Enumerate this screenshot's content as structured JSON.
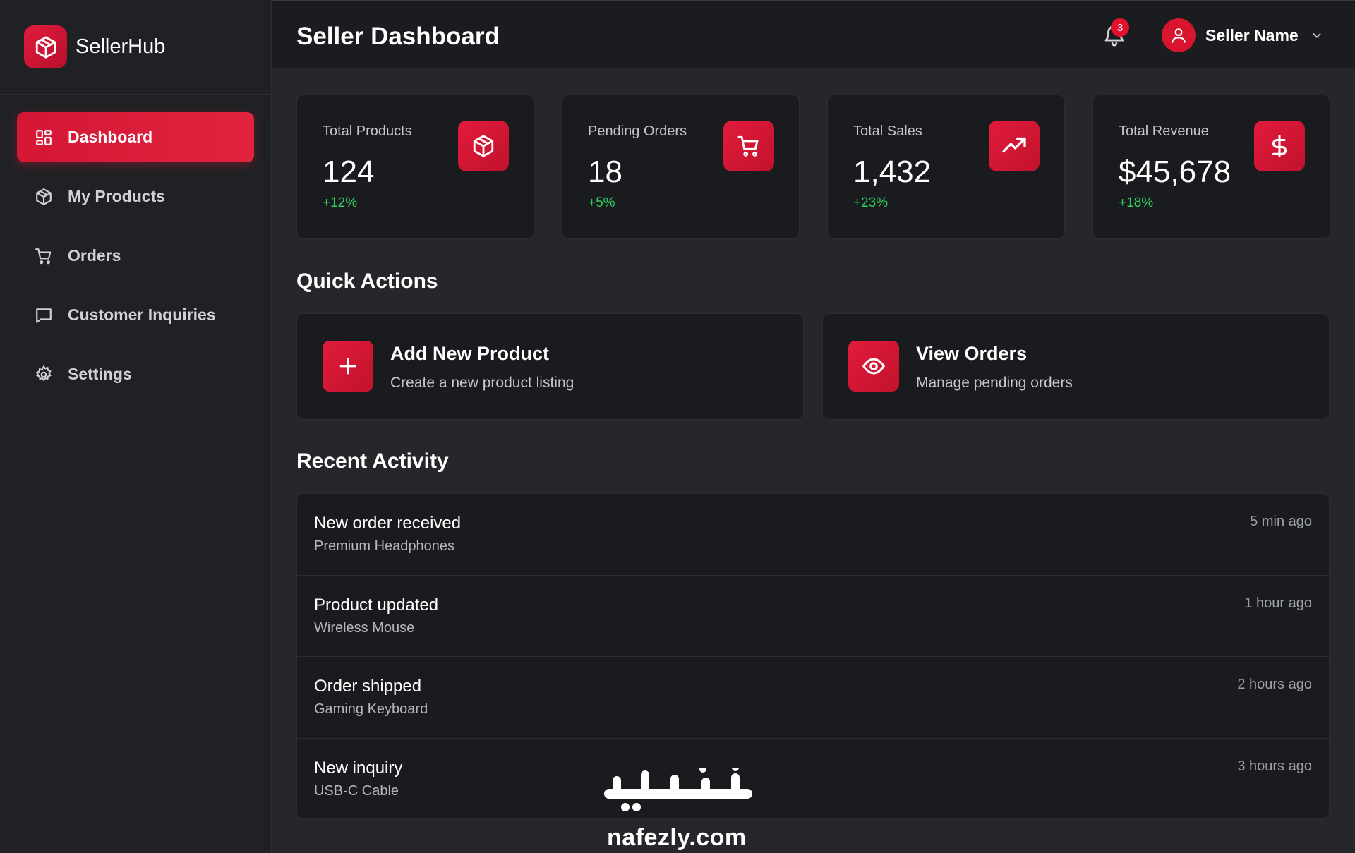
{
  "sidebar": {
    "brand": "SellerHub",
    "items": [
      {
        "label": "Dashboard",
        "icon": "grid-icon",
        "active": true
      },
      {
        "label": "My Products",
        "icon": "box-icon",
        "active": false
      },
      {
        "label": "Orders",
        "icon": "cart-icon",
        "active": false
      },
      {
        "label": "Customer Inquiries",
        "icon": "message-icon",
        "active": false
      },
      {
        "label": "Settings",
        "icon": "gear-icon",
        "active": false
      }
    ]
  },
  "header": {
    "title": "Seller Dashboard",
    "notifications_count": "3",
    "user_name": "Seller Name"
  },
  "stats": [
    {
      "label": "Total Products",
      "value": "124",
      "change": "+12%",
      "icon": "box-icon"
    },
    {
      "label": "Pending Orders",
      "value": "18",
      "change": "+5%",
      "icon": "cart-icon"
    },
    {
      "label": "Total Sales",
      "value": "1,432",
      "change": "+23%",
      "icon": "trending-up-icon"
    },
    {
      "label": "Total Revenue",
      "value": "$45,678",
      "change": "+18%",
      "icon": "dollar-icon"
    }
  ],
  "quick_actions": {
    "title": "Quick Actions",
    "items": [
      {
        "title": "Add New Product",
        "subtitle": "Create a new product listing",
        "icon": "plus-icon"
      },
      {
        "title": "View Orders",
        "subtitle": "Manage pending orders",
        "icon": "eye-icon"
      }
    ]
  },
  "recent_activity": {
    "title": "Recent Activity",
    "items": [
      {
        "title": "New order received",
        "subtitle": "Premium Headphones",
        "time": "5 min ago"
      },
      {
        "title": "Product updated",
        "subtitle": "Wireless Mouse",
        "time": "1 hour ago"
      },
      {
        "title": "Order shipped",
        "subtitle": "Gaming Keyboard",
        "time": "2 hours ago"
      },
      {
        "title": "New inquiry",
        "subtitle": "USB-C Cable",
        "time": "3 hours ago"
      }
    ]
  },
  "watermark": {
    "arabic": "نفذلي",
    "url": "nafezly.com"
  },
  "colors": {
    "accent": "#e21b3c",
    "positive": "#2fcf5c",
    "background": "#25272b",
    "card": "#1a1b1e"
  }
}
